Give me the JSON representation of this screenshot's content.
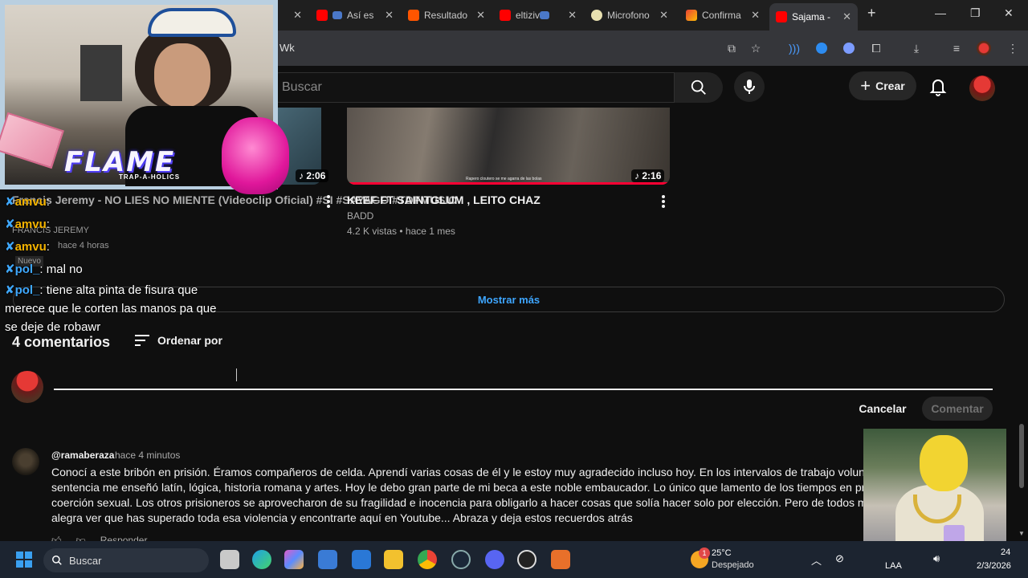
{
  "browser": {
    "tabs": [
      {
        "label": "",
        "favicon": "stream-icon"
      },
      {
        "label": "Así es",
        "favicon": "youtube-icon"
      },
      {
        "label": "Resultado",
        "favicon": "soundcloud-icon"
      },
      {
        "label": "eltiziv",
        "favicon": "youtube-icon"
      },
      {
        "label": "Microfono",
        "favicon": "browser-icon"
      },
      {
        "label": "Confirma",
        "favicon": "gmail-icon"
      },
      {
        "label": "Sajama -",
        "favicon": "youtube-icon"
      }
    ],
    "new_tab_label": "+",
    "address_fragment": "Wk"
  },
  "youtube": {
    "search_placeholder": "Buscar",
    "create_label": "Crear"
  },
  "videos": [
    {
      "title": "Francis Jeremy - NO LIES NO MIENTE (Videoclip Oficial) #SI #SAYAGO #TDFMUSIC",
      "channel": "FRANCIS JEREMY",
      "meta": "hace 4 horas",
      "badge": "Nuevo",
      "duration": "2:06"
    },
    {
      "title": "KEEF FT SAINTGLUM , LEITO CHAZ",
      "channel": "BADD",
      "meta": "4.2 K vistas • hace 1 mes",
      "duration": "2:16",
      "caption": "Rapero cloutero se me agarra de las bolas"
    }
  ],
  "show_more_label": "Mostrar más",
  "comments": {
    "count_label": "4 comentarios",
    "sort_label": "Ordenar por",
    "cancel_label": "Cancelar",
    "submit_label": "Comentar",
    "items": [
      {
        "user": "@ramaberaza",
        "time": "hace 4 minutos",
        "lines": [
          "Conocí a este bribón en prisión. Éramos compañeros de celda. Aprendí varias cosas de él y le estoy muy agradecido incluso hoy. En los intervalos de trabajo voluntario que hi",
          "sentencia me enseñó latín, lógica, historia romana y artes. Hoy le debo gran parte de mi beca a este noble embaucador. Lo único que lamento de los tiempos en prisión es qu",
          "coerción sexual. Los otros prisioneros se aprovecharon de su fragilidad e inocencia para obligarlo a hacer cosas que solía hacer solo por elección. Pero de todos modos, son",
          "alegra ver que has superado toda esa violencia y encontrarte aquí en Youtube... Abraza y deja estos recuerdos atrás"
        ],
        "reply_label": "Responder"
      }
    ]
  },
  "stream_overlay": {
    "logo_text": "FLAME",
    "logo_sub": "TRAP-A-HOLICS",
    "chat": [
      {
        "user": "amvu",
        "text": ":"
      },
      {
        "user": "amvu",
        "text": ":"
      },
      {
        "user": "amvu",
        "text": ":"
      },
      {
        "user": "pol_",
        "text": ": mal no"
      },
      {
        "user": "pol_",
        "text": ": tiene alta pinta de fisura que merece que le corten las manos pa que se deje de robawr"
      }
    ]
  },
  "taskbar": {
    "search_label": "Buscar",
    "weather_temp": "25°C",
    "weather_desc": "Despejado",
    "weather_badge": "1",
    "language": "LAA",
    "date": "2/3/2026",
    "time_fragment": "24"
  }
}
